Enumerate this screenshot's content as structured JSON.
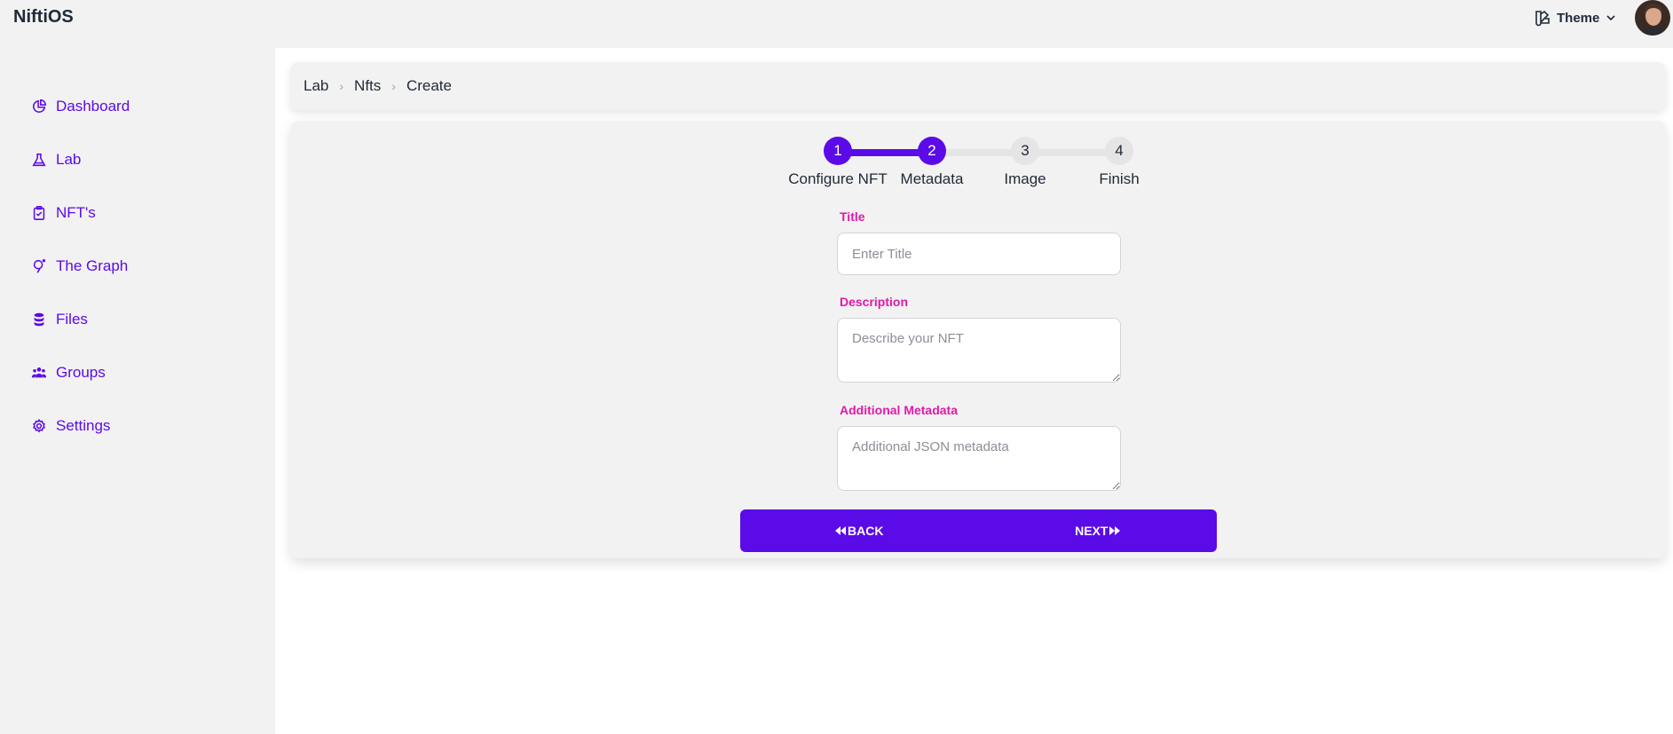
{
  "app": {
    "brand": "NiftiOS"
  },
  "header": {
    "theme_label": "Theme"
  },
  "sidebar": {
    "items": [
      {
        "label": "Dashboard",
        "icon": "chart-pie-icon"
      },
      {
        "label": "Lab",
        "icon": "beaker-icon"
      },
      {
        "label": "NFT's",
        "icon": "clipboard-check-icon"
      },
      {
        "label": "The Graph",
        "icon": "graph-icon"
      },
      {
        "label": "Files",
        "icon": "database-icon"
      },
      {
        "label": "Groups",
        "icon": "users-icon"
      },
      {
        "label": "Settings",
        "icon": "gear-icon"
      }
    ]
  },
  "breadcrumb": [
    "Lab",
    "Nfts",
    "Create"
  ],
  "stepper": {
    "current_step": 2,
    "steps": [
      {
        "number": "1",
        "label": "Configure NFT"
      },
      {
        "number": "2",
        "label": "Metadata"
      },
      {
        "number": "3",
        "label": "Image"
      },
      {
        "number": "4",
        "label": "Finish"
      }
    ]
  },
  "form": {
    "title": {
      "label": "Title",
      "placeholder": "Enter Title",
      "value": ""
    },
    "description": {
      "label": "Description",
      "placeholder": "Describe your NFT",
      "value": ""
    },
    "metadata": {
      "label": "Additional Metadata",
      "placeholder": "Additional JSON metadata",
      "value": ""
    }
  },
  "actions": {
    "back_label": "BACK",
    "next_label": "NEXT"
  },
  "colors": {
    "accent": "#5b0be8",
    "label_pink": "#e01aa8",
    "panel": "#f2f2f2"
  }
}
